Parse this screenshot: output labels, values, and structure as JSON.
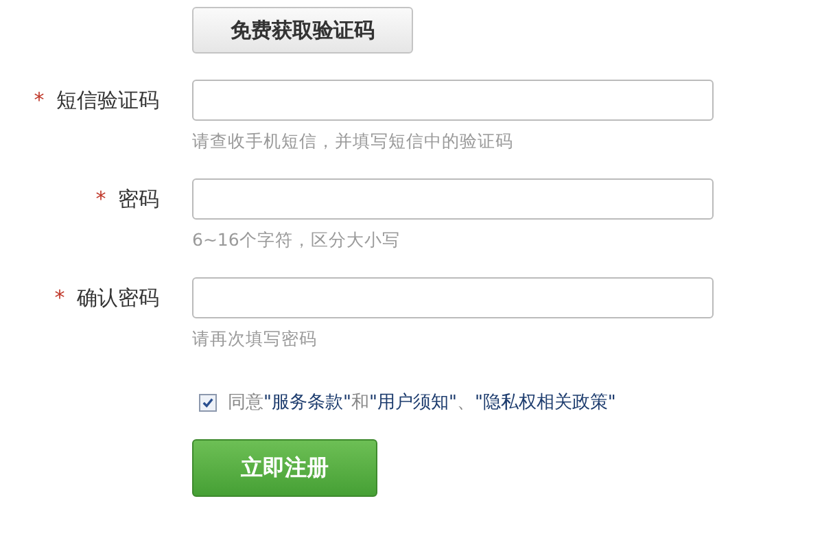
{
  "code_button": "免费获取验证码",
  "fields": [
    {
      "label": "短信验证码",
      "required_mark": "*",
      "hint": "请查收手机短信，并填写短信中的验证码"
    },
    {
      "label": "密码",
      "required_mark": "*",
      "hint": "6~16个字符，区分大小写"
    },
    {
      "label": "确认密码",
      "required_mark": "*",
      "hint": "请再次填写密码"
    }
  ],
  "agreement": {
    "checked": true,
    "parts": [
      {
        "kind": "plain",
        "text": "同意"
      },
      {
        "kind": "link",
        "text": "\"服务条款\""
      },
      {
        "kind": "plain",
        "text": "和"
      },
      {
        "kind": "link",
        "text": "\"用户须知\""
      },
      {
        "kind": "plain",
        "text": "、"
      },
      {
        "kind": "link",
        "text": "\"隐私权相关政策\""
      }
    ]
  },
  "register_button": "立即注册"
}
